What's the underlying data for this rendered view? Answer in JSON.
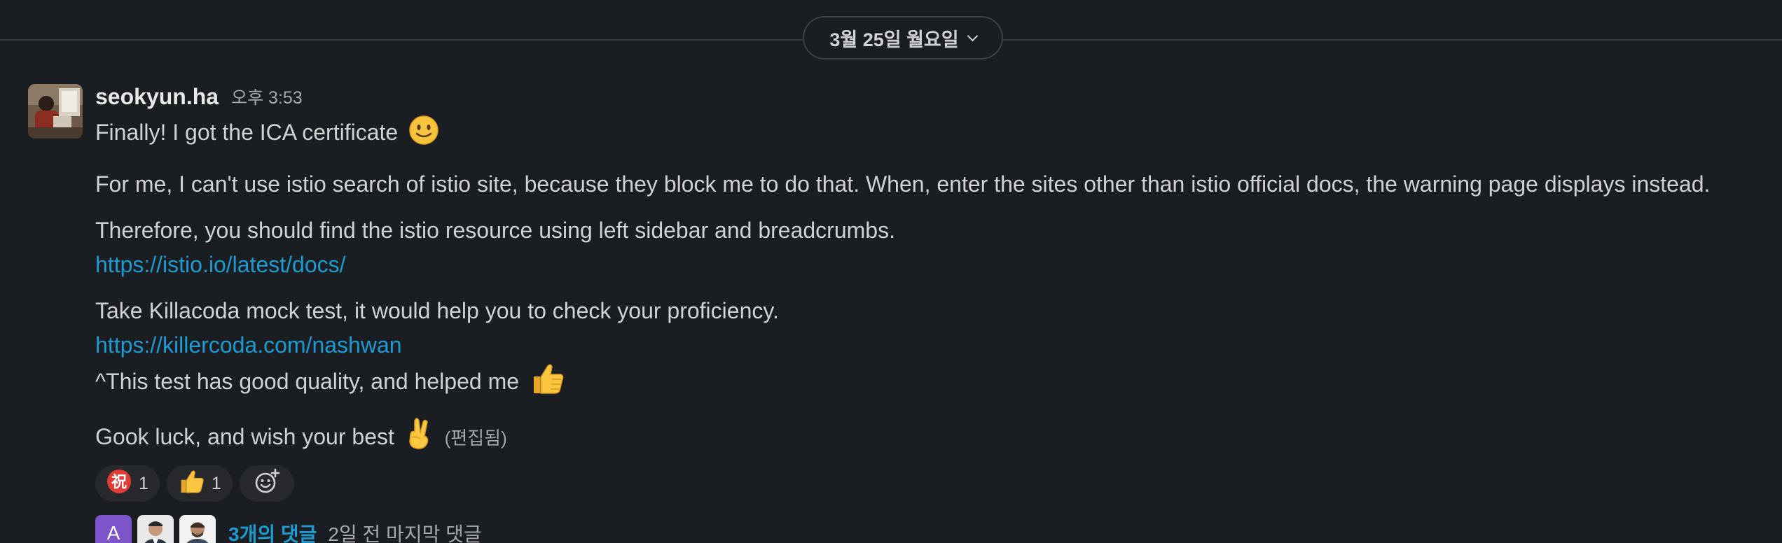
{
  "date_divider": {
    "label": "3월 25일 월요일"
  },
  "message": {
    "author": "seokyun.ha",
    "timestamp": "오후 3:53",
    "paragraphs": [
      "Finally! I got the ICA certificate",
      "For me, I can't use istio search of istio site, because they block me to do that. When, enter the sites other than istio official docs, the warning page displays instead.",
      "Therefore, you should find the istio resource using left sidebar and breadcrumbs.",
      "https://istio.io/latest/docs/",
      "Take Killacoda mock test, it would help you to check your proficiency.",
      "https://killercoda.com/nashwan",
      "^This test has good quality, and helped me",
      "Gook luck, and wish your best"
    ],
    "edited_label": "(편집됨)"
  },
  "reactions": [
    {
      "emoji": "congratulations-emoji",
      "glyph": "祝",
      "count": "1"
    },
    {
      "emoji": "thumbs-up-emoji",
      "count": "1"
    }
  ],
  "thread": {
    "avatar_letter": "A",
    "reply_count": "3개의 댓글",
    "last_reply": "2일 전 마지막 댓글"
  },
  "colors": {
    "background": "#1a1d21",
    "link": "#1d9bd1",
    "text": "#d1d2d3",
    "muted": "#a6a8ab",
    "avatar_purple": "#7b55c9",
    "reaction_bg": "#27292d"
  }
}
